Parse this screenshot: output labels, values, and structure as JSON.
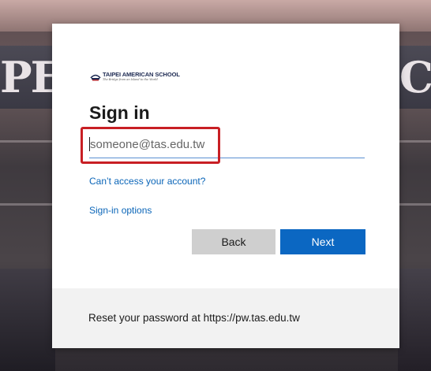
{
  "background": {
    "sign_left_text": "PE",
    "sign_right_text": "C"
  },
  "dialog": {
    "logo": {
      "name": "TAIPEI AMERICAN SCHOOL",
      "tagline": "The Bridge from an Island to the World"
    },
    "title": "Sign in",
    "email_field": {
      "placeholder": "someone@tas.edu.tw",
      "value": ""
    },
    "links": {
      "cant_access": "Can’t access your account?",
      "signin_options": "Sign-in options"
    },
    "buttons": {
      "back": "Back",
      "next": "Next"
    },
    "footer_text": "Reset your password at https://pw.tas.edu.tw"
  },
  "colors": {
    "accent": "#0b67c2",
    "link": "#0a65b8",
    "highlight_box": "#c81f24",
    "back_button": "#cfcfcf",
    "footer_bg": "#f2f2f2"
  },
  "icons": {
    "logo_mark": "school-logo-icon"
  }
}
